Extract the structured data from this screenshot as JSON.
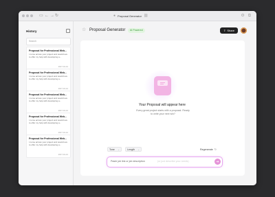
{
  "browser": {
    "url_title": "Proposal Generator",
    "back": "←",
    "forward": "→",
    "reload": "↻",
    "lock": "🔒",
    "link": "🔗"
  },
  "sidebar": {
    "title": "History",
    "search_placeholder": "Search",
    "items": [
      {
        "title": "Proposal for Professional Web...",
        "desc": "I come across your project and would love to offer my help with developing a...",
        "date": "2017-01-12"
      },
      {
        "title": "Proposal for Professional Web...",
        "desc": "I come across your project and would love to offer my help with developing a...",
        "date": "2017-01-12"
      },
      {
        "title": "Proposal for Professional Web...",
        "desc": "I come across your project and would love to offer my help with developing a...",
        "date": "2017-01-12"
      },
      {
        "title": "Proposal for Professional Web...",
        "desc": "I come across your project and would love to offer my help with developing a...",
        "date": "2017-01-12"
      },
      {
        "title": "Proposal for Professional Web...",
        "desc": "I come across your project and would love to offer my help with developing a...",
        "date": "2017-01-12"
      }
    ]
  },
  "header": {
    "title": "Proposal Generator",
    "badge": "AI Powered",
    "share": "Share"
  },
  "empty_state": {
    "title": "Your Proposal will appear here",
    "subtitle": "Every great project starts with a proposal. Ready to write your next win?"
  },
  "controls": {
    "tone": "Tone",
    "length": "Length",
    "regenerate": "Regenerate",
    "input_placeholder": "Paste job link or job description",
    "input_hint": "(or just describe your needs)"
  },
  "colors": {
    "accent": "#e593d8",
    "badge_bg": "#e2f5e0",
    "badge_text": "#3a9a3a"
  }
}
